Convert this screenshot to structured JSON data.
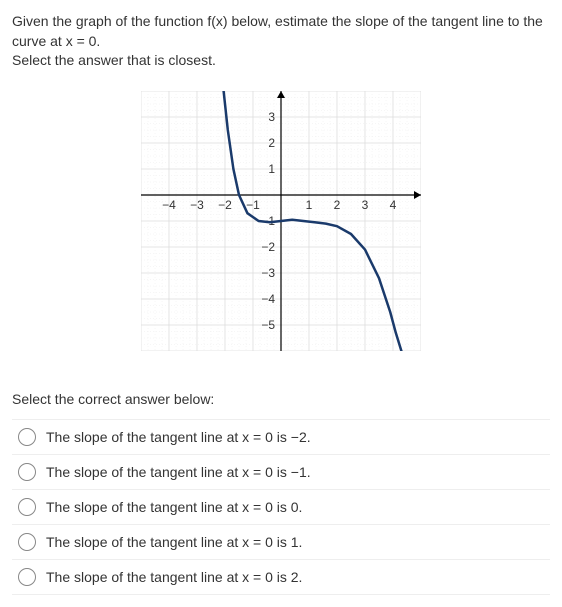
{
  "question": {
    "line1": "Given the graph of the function f(x) below, estimate the slope of the tangent line to the curve at x = 0.",
    "line2": "Select the answer that is closest."
  },
  "chart_data": {
    "type": "line",
    "xlim": [
      -5,
      5
    ],
    "ylim": [
      -6,
      4
    ],
    "x_ticks": [
      -4,
      -3,
      -2,
      -1,
      1,
      2,
      3,
      4
    ],
    "y_ticks": [
      -5,
      -4,
      -3,
      -2,
      -1,
      1,
      2,
      3
    ],
    "series": [
      {
        "name": "f(x)",
        "color": "#1a3a6b",
        "points": [
          {
            "x": -2.05,
            "y": 4.0
          },
          {
            "x": -1.9,
            "y": 2.5
          },
          {
            "x": -1.7,
            "y": 1.0
          },
          {
            "x": -1.5,
            "y": 0.0
          },
          {
            "x": -1.2,
            "y": -0.7
          },
          {
            "x": -0.8,
            "y": -1.0
          },
          {
            "x": -0.4,
            "y": -1.05
          },
          {
            "x": 0.0,
            "y": -1.0
          },
          {
            "x": 0.4,
            "y": -0.95
          },
          {
            "x": 0.8,
            "y": -1.0
          },
          {
            "x": 1.2,
            "y": -1.05
          },
          {
            "x": 1.6,
            "y": -1.1
          },
          {
            "x": 2.0,
            "y": -1.2
          },
          {
            "x": 2.5,
            "y": -1.5
          },
          {
            "x": 3.0,
            "y": -2.1
          },
          {
            "x": 3.5,
            "y": -3.2
          },
          {
            "x": 3.9,
            "y": -4.5
          },
          {
            "x": 4.1,
            "y": -5.3
          },
          {
            "x": 4.3,
            "y": -6.0
          }
        ]
      }
    ]
  },
  "answer_prompt": "Select the correct answer below:",
  "options": [
    "The slope of the tangent line at x = 0 is −2.",
    "The slope of the tangent line at x = 0 is −1.",
    "The slope of the tangent line at x = 0 is 0.",
    "The slope of the tangent line at x = 0 is 1.",
    "The slope of the tangent line at x = 0 is 2."
  ]
}
